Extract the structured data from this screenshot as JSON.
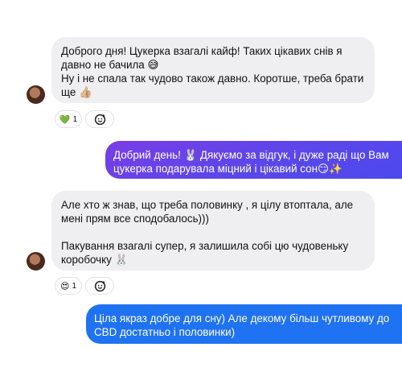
{
  "messages": [
    {
      "text": "Доброго дня! Цукерка взагалі кайф! Таких цікавих снів я давно не бачила 😅\nНу і не спала так чудово також давно. Коротше, треба брати ще 👍🏼",
      "reaction": {
        "emoji": "💚",
        "count": "1"
      }
    },
    {
      "line1": "Добрий день! 🐰 Дякуємо за відгук, і дуже раді що Вам",
      "line2": "цукерка подарувала міцний і цікавий сон😏✨"
    },
    {
      "text": "Але хто ж знав, що треба половинку , я цілу втоптала, але мені прям все сподобалось)))\n\nПакування взагалі супер, я залишила собі цю чудовеньку коробочку 🐰",
      "reaction": {
        "emoji": "😍",
        "count": "1"
      }
    },
    {
      "line1": "Ціла якраз добре для сну) Але декому більш чутливому до",
      "line2": "CBD достатньо і половинки)"
    }
  ],
  "colors": {
    "outgoing_gradient_top": "#7a3de6",
    "outgoing_gradient_mid": "#4c48ee",
    "outgoing_blue": "#1f72f2",
    "incoming_bg": "#efeff1"
  }
}
